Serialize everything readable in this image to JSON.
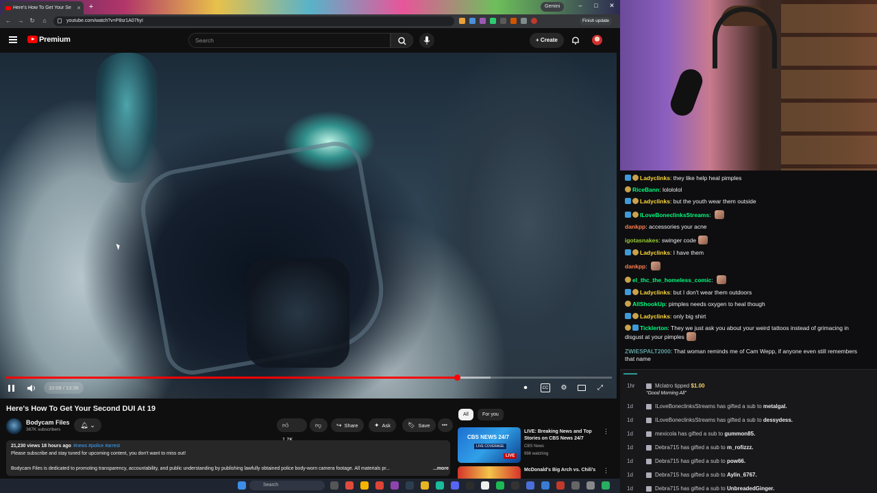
{
  "browser": {
    "tab_title": "Here's How To Get Your Se",
    "url": "youtube.com/watch?v=P8sr1A07hyI",
    "gemini": "Gemini",
    "finish_update": "Finish update"
  },
  "youtube": {
    "brand": "Premium",
    "search_placeholder": "Search",
    "create_label": "Create"
  },
  "player": {
    "time": "10:08 / 13:36",
    "progress_fraction": 0.745,
    "buffer_fraction": 0.8
  },
  "video": {
    "title": "Here's How To Get Your Second DUI At 19",
    "channel": "Bodycam Files",
    "subscribers": "367K subscribers",
    "likes": "1.2K",
    "share_label": "Share",
    "ask_label": "Ask",
    "save_label": "Save",
    "meta": "21,230 views  18 hours ago",
    "tags": "#news #police #arrest",
    "desc_line1": "Please subscribe and stay tuned for upcoming content, you don't want to miss out!",
    "desc_line2": "Bodycam Files is dedicated to promoting transparency, accountability, and public understanding by publishing lawfully obtained police body-worn camera footage. All materials pr...",
    "more_label": "...more"
  },
  "recommendations": {
    "chips": [
      "All",
      "For you"
    ],
    "items": [
      {
        "title": "LIVE: Breaking News and Top Stories on CBS News 24/7",
        "channel": "CBS News",
        "watching": "998 watching",
        "thumb_brand": "CBS NEWS 24/7",
        "thumb_tag": "LIVE COVERAGE",
        "badge": "LIVE"
      },
      {
        "title": "McDonald's Big Arch vs. Chili's"
      }
    ]
  },
  "taskbar": {
    "search_label": "Search"
  },
  "chat": {
    "messages": [
      {
        "user": "Ladyclinks",
        "color": "#ffd83a",
        "text": "they like help heal pimples"
      },
      {
        "user": "RiceBann",
        "color": "#00ff7f",
        "text": "lolololol"
      },
      {
        "user": "Ladyclinks",
        "color": "#ffd83a",
        "text": "but the youth wear them outside"
      },
      {
        "user": "ILoveBoneclinksStreams",
        "color": "#00ff7f",
        "text": ""
      },
      {
        "user": "dankpp",
        "color": "#ff7f50",
        "text": "accessories your acne"
      },
      {
        "user": "igotasnakes",
        "color": "#9acd32",
        "text": "swinger code"
      },
      {
        "user": "Ladyclinks",
        "color": "#ffd83a",
        "text": "I have them"
      },
      {
        "user": "dankpp",
        "color": "#ff7f50",
        "text": ""
      },
      {
        "user": "el_thc_the_homeless_comic",
        "color": "#00ff7f",
        "text": ""
      },
      {
        "user": "Ladyclinks",
        "color": "#ffd83a",
        "text": "but I don't wear them outdoors"
      },
      {
        "user": "AllShookUp",
        "color": "#00ff7f",
        "text": "pimples needs oxygen to heal though"
      },
      {
        "user": "Ladyclinks",
        "color": "#ffd83a",
        "text": "only big shirt"
      },
      {
        "user": "Ticklerton",
        "color": "#00ff7f",
        "text": "They we just ask you about your weird tattoos instead of grimacing in disgust at your pimples"
      },
      {
        "user": "ZWIESPALT2000",
        "color": "#5f9ea0",
        "text": "That woman reminds me of Cam Wepp, if anyone even still remembers that name"
      }
    ]
  },
  "events": {
    "tip": {
      "time": "1hr",
      "user": "Mclatro",
      "verb": "tipped",
      "amount": "$1.00",
      "note": "\"Good Morning All\""
    },
    "gifts": [
      {
        "time": "1d",
        "user": "ILoveBoneclinksStreams",
        "verb": "has gifted a sub to",
        "target": "metalgal"
      },
      {
        "time": "1d",
        "user": "ILoveBoneclinksStreams",
        "verb": "has gifted a sub to",
        "target": "dessydess"
      },
      {
        "time": "1d",
        "user": "mexicola",
        "verb": "has gifted a sub to",
        "target": "gummon85"
      },
      {
        "time": "1d",
        "user": "Debra715",
        "verb": "has gifted a sub to",
        "target": "m_rofizzz"
      },
      {
        "time": "1d",
        "user": "Debra715",
        "verb": "has gifted a sub to",
        "target": "pow66"
      },
      {
        "time": "1d",
        "user": "Debra715",
        "verb": "has gifted a sub to",
        "target": "Aylin_6767"
      },
      {
        "time": "1d",
        "user": "Debra715",
        "verb": "has gifted a sub to",
        "target": "UnbreadedGinger"
      }
    ]
  }
}
